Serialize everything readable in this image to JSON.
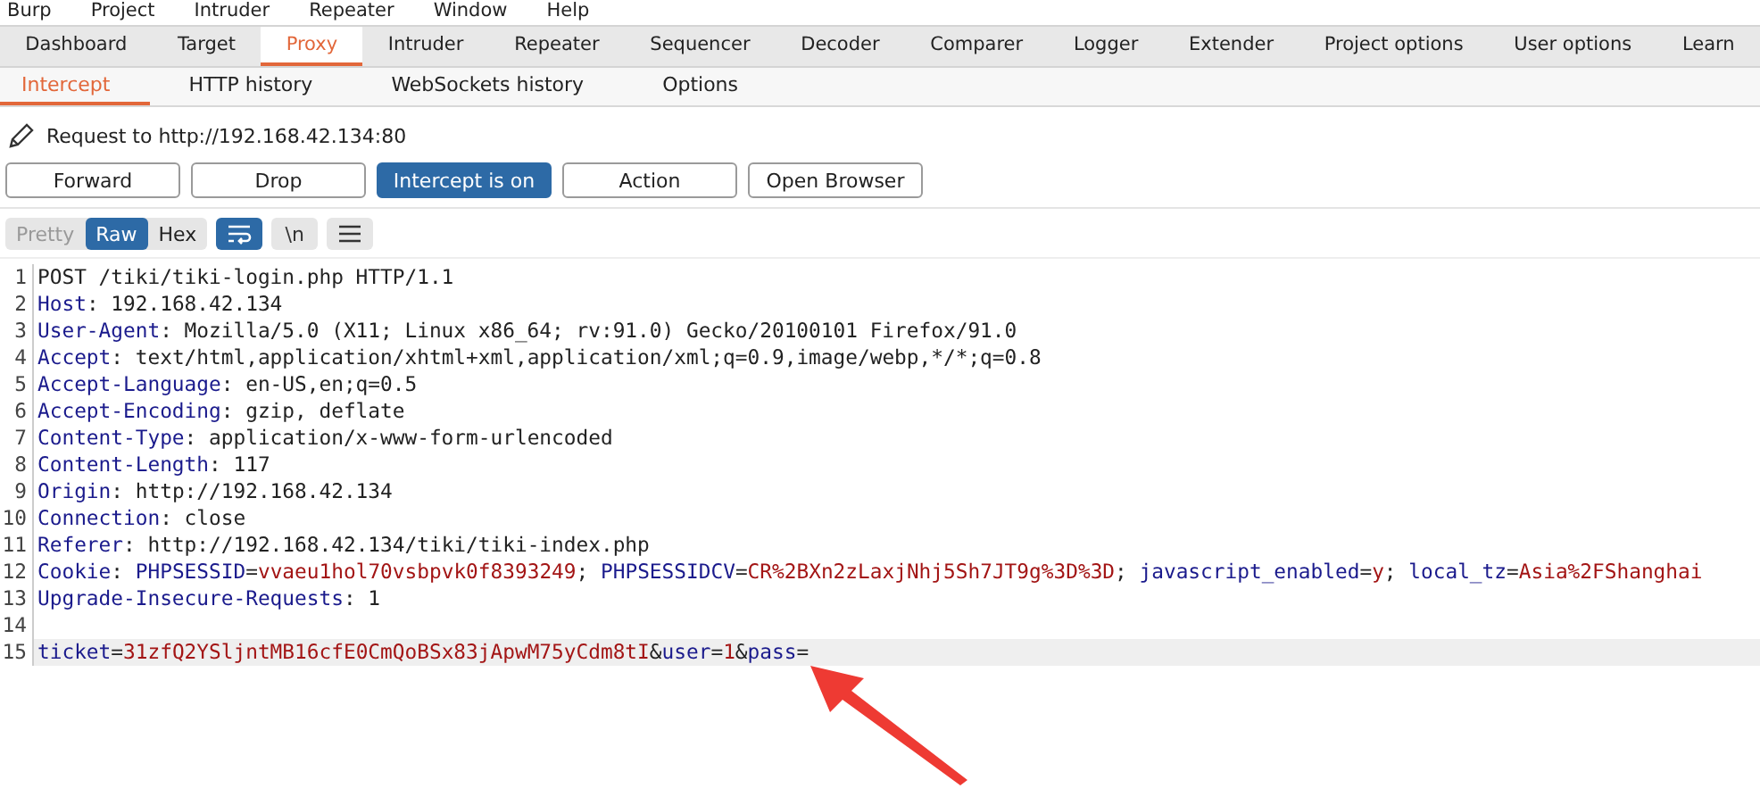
{
  "menu": [
    "Burp",
    "Project",
    "Intruder",
    "Repeater",
    "Window",
    "Help"
  ],
  "tabs": [
    {
      "label": "Dashboard",
      "selected": false
    },
    {
      "label": "Target",
      "selected": false
    },
    {
      "label": "Proxy",
      "selected": true
    },
    {
      "label": "Intruder",
      "selected": false
    },
    {
      "label": "Repeater",
      "selected": false
    },
    {
      "label": "Sequencer",
      "selected": false
    },
    {
      "label": "Decoder",
      "selected": false
    },
    {
      "label": "Comparer",
      "selected": false
    },
    {
      "label": "Logger",
      "selected": false
    },
    {
      "label": "Extender",
      "selected": false
    },
    {
      "label": "Project options",
      "selected": false
    },
    {
      "label": "User options",
      "selected": false
    },
    {
      "label": "Learn",
      "selected": false
    }
  ],
  "subtabs": [
    {
      "label": "Intercept",
      "selected": true
    },
    {
      "label": "HTTP history",
      "selected": false
    },
    {
      "label": "WebSockets history",
      "selected": false
    },
    {
      "label": "Options",
      "selected": false
    }
  ],
  "request_to": "Request to http://192.168.42.134:80",
  "buttons": [
    {
      "label": "Forward",
      "selected": false
    },
    {
      "label": "Drop",
      "selected": false
    },
    {
      "label": "Intercept is on",
      "selected": true
    },
    {
      "label": "Action",
      "selected": false
    },
    {
      "label": "Open Browser",
      "selected": false
    }
  ],
  "view_modes": [
    {
      "label": "Pretty",
      "selected": false,
      "disabled": true
    },
    {
      "label": "Raw",
      "selected": true,
      "disabled": false
    },
    {
      "label": "Hex",
      "selected": false,
      "disabled": false
    }
  ],
  "editor_tools": [
    {
      "kind": "wrap",
      "selected": true
    },
    {
      "kind": "newline",
      "label": "\\n",
      "selected": false
    },
    {
      "kind": "menu",
      "selected": false
    }
  ],
  "lines": [
    {
      "number": "1",
      "highlighted": false,
      "segments": [
        {
          "text": "POST /tiki/tiki-login.php HTTP/1.1",
          "kind": "plain"
        }
      ]
    },
    {
      "number": "2",
      "highlighted": false,
      "segments": [
        {
          "text": "Host",
          "kind": "key"
        },
        {
          "text": ": 192.168.42.134",
          "kind": "plain"
        }
      ]
    },
    {
      "number": "3",
      "highlighted": false,
      "segments": [
        {
          "text": "User-Agent",
          "kind": "key"
        },
        {
          "text": ": Mozilla/5.0 (X11; Linux x86_64; rv:91.0) Gecko/20100101 Firefox/91.0",
          "kind": "plain"
        }
      ]
    },
    {
      "number": "4",
      "highlighted": false,
      "segments": [
        {
          "text": "Accept",
          "kind": "key"
        },
        {
          "text": ": text/html,application/xhtml+xml,application/xml;q=0.9,image/webp,*/*;q=0.8",
          "kind": "plain"
        }
      ]
    },
    {
      "number": "5",
      "highlighted": false,
      "segments": [
        {
          "text": "Accept-Language",
          "kind": "key"
        },
        {
          "text": ": en-US,en;q=0.5",
          "kind": "plain"
        }
      ]
    },
    {
      "number": "6",
      "highlighted": false,
      "segments": [
        {
          "text": "Accept-Encoding",
          "kind": "key"
        },
        {
          "text": ": gzip, deflate",
          "kind": "plain"
        }
      ]
    },
    {
      "number": "7",
      "highlighted": false,
      "segments": [
        {
          "text": "Content-Type",
          "kind": "key"
        },
        {
          "text": ": application/x-www-form-urlencoded",
          "kind": "plain"
        }
      ]
    },
    {
      "number": "8",
      "highlighted": false,
      "segments": [
        {
          "text": "Content-Length",
          "kind": "key"
        },
        {
          "text": ": 117",
          "kind": "plain"
        }
      ]
    },
    {
      "number": "9",
      "highlighted": false,
      "segments": [
        {
          "text": "Origin",
          "kind": "key"
        },
        {
          "text": ": http://192.168.42.134",
          "kind": "plain"
        }
      ]
    },
    {
      "number": "10",
      "highlighted": false,
      "segments": [
        {
          "text": "Connection",
          "kind": "key"
        },
        {
          "text": ": close",
          "kind": "plain"
        }
      ]
    },
    {
      "number": "11",
      "highlighted": false,
      "segments": [
        {
          "text": "Referer",
          "kind": "key"
        },
        {
          "text": ": http://192.168.42.134/tiki/tiki-index.php",
          "kind": "plain"
        }
      ]
    },
    {
      "number": "12",
      "highlighted": false,
      "segments": [
        {
          "text": "Cookie",
          "kind": "key"
        },
        {
          "text": ": ",
          "kind": "plain"
        },
        {
          "text": "PHPSESSID",
          "kind": "key"
        },
        {
          "text": "=",
          "kind": "plain"
        },
        {
          "text": "vvaeu1hol70vsbpvk0f8393249",
          "kind": "value"
        },
        {
          "text": "; ",
          "kind": "plain"
        },
        {
          "text": "PHPSESSIDCV",
          "kind": "key"
        },
        {
          "text": "=",
          "kind": "plain"
        },
        {
          "text": "CR%2BXn2zLaxjNhj5Sh7JT9g%3D%3D",
          "kind": "value"
        },
        {
          "text": "; ",
          "kind": "plain"
        },
        {
          "text": "javascript_enabled",
          "kind": "key"
        },
        {
          "text": "=",
          "kind": "plain"
        },
        {
          "text": "y",
          "kind": "value"
        },
        {
          "text": "; ",
          "kind": "plain"
        },
        {
          "text": "local_tz",
          "kind": "key"
        },
        {
          "text": "=",
          "kind": "plain"
        },
        {
          "text": "Asia%2FShanghai",
          "kind": "value"
        }
      ]
    },
    {
      "number": "13",
      "highlighted": false,
      "segments": [
        {
          "text": "Upgrade-Insecure-Requests",
          "kind": "key"
        },
        {
          "text": ": 1",
          "kind": "plain"
        }
      ]
    },
    {
      "number": "14",
      "highlighted": false
    },
    {
      "number": "15",
      "highlighted": true,
      "segments": [
        {
          "text": "ticket",
          "kind": "key"
        },
        {
          "text": "=",
          "kind": "plain"
        },
        {
          "text": "31zfQ2YSljntMB16cfE0CmQoBSx83jApwM75yCdm8tI",
          "kind": "value"
        },
        {
          "text": "&",
          "kind": "plain"
        },
        {
          "text": "user",
          "kind": "key"
        },
        {
          "text": "=",
          "kind": "plain"
        },
        {
          "text": "1",
          "kind": "value"
        },
        {
          "text": "&",
          "kind": "plain"
        },
        {
          "text": "pass",
          "kind": "key"
        },
        {
          "text": "=",
          "kind": "plain"
        }
      ]
    }
  ]
}
